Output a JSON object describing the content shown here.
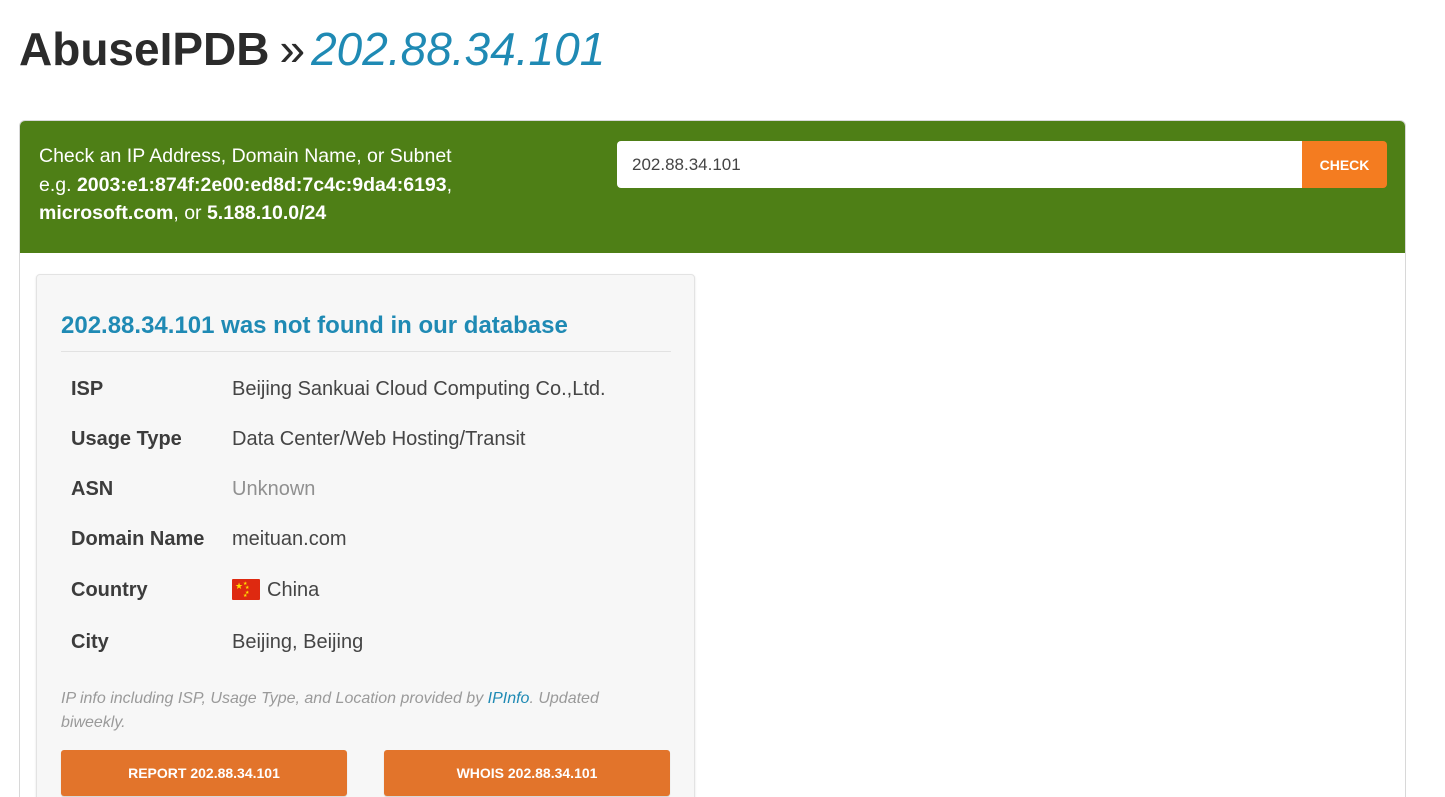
{
  "header": {
    "site_name": "AbuseIPDB",
    "separator": "»",
    "ip": "202.88.34.101"
  },
  "search": {
    "help_line1": "Check an IP Address, Domain Name, or Subnet",
    "help_eg": "e.g. ",
    "example_ipv6": "2003:e1:874f:2e00:ed8d:7c4c:9da4:6193",
    "comma": ",",
    "example_domain": "microsoft.com",
    "or_text": ", or ",
    "example_subnet": "5.188.10.0/24",
    "value": "202.88.34.101",
    "check_label": "CHECK"
  },
  "result": {
    "ip": "202.88.34.101",
    "heading_suffix": " was not found in our database",
    "rows": [
      {
        "label": "ISP",
        "value": "Beijing Sankuai Cloud Computing Co.,Ltd."
      },
      {
        "label": "Usage Type",
        "value": "Data Center/Web Hosting/Transit"
      },
      {
        "label": "ASN",
        "value": "Unknown"
      },
      {
        "label": "Domain Name",
        "value": "meituan.com"
      },
      {
        "label": "Country",
        "value": "China"
      },
      {
        "label": "City",
        "value": "Beijing, Beijing"
      }
    ],
    "country_flag_icon": "china-flag-icon",
    "attribution_prefix": "IP info including ISP, Usage Type, and Location provided by ",
    "attribution_link": "IPInfo",
    "attribution_suffix": ". Updated biweekly.",
    "report_label": "REPORT 202.88.34.101",
    "whois_label": "WHOIS 202.88.34.101"
  },
  "colors": {
    "brand_green": "#4e7f16",
    "accent_orange": "#f47c20",
    "button_orange": "#e2742b",
    "link_blue": "#1f8ab4"
  }
}
